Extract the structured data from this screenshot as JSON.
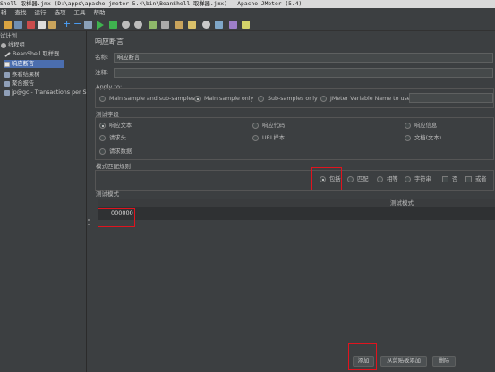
{
  "window": {
    "title": "Shell 取样器.jmx (D:\\apps\\apache-jmeter-5.4\\bin\\BeanShell 取样器.jmx) - Apache JMeter (5.4)"
  },
  "menu": [
    "辑",
    "查找",
    "运行",
    "选项",
    "工具",
    "帮助"
  ],
  "tree": {
    "items": [
      {
        "label": "试计划",
        "icon": "test-plan-icon"
      },
      {
        "label": "线程组",
        "icon": "thread-group-icon"
      },
      {
        "label": "BeanShell 取样器",
        "icon": "pen-icon"
      },
      {
        "label": "响应断言",
        "icon": "assertion-icon",
        "selected": true
      },
      {
        "label": "察看结果树",
        "icon": "listener-icon"
      },
      {
        "label": "聚合报告",
        "icon": "listener-icon"
      },
      {
        "label": "jp@gc - Transactions per S",
        "icon": "listener-icon"
      }
    ]
  },
  "panel": {
    "title": "响应断言",
    "name_label": "名称:",
    "name_value": "响应断言",
    "comment_label": "注释:",
    "comment_value": "",
    "apply_to": {
      "label": "Apply to:",
      "options": [
        "Main sample and sub-samples",
        "Main sample only",
        "Sub-samples only",
        "JMeter Variable Name to use"
      ],
      "selected": "Main sample only"
    },
    "test_field": {
      "label": "测试字段",
      "options": [
        "响应文本",
        "响应代码",
        "响应信息",
        "请求头",
        "URL样本",
        "文档(文本)",
        "请求数据"
      ],
      "selected": "响应文本"
    },
    "match_rules": {
      "label": "模式匹配规则",
      "options": [
        "包括",
        "匹配",
        "相等",
        "字符串"
      ],
      "selected": "包括",
      "checkbox_not": "否",
      "checkbox_or": "或者"
    },
    "patterns": {
      "label": "测试模式",
      "column": "测试模式",
      "rows": [
        "000000"
      ]
    },
    "buttons": {
      "add": "添加",
      "add_clipboard": "从剪贴板添加",
      "delete": "删除"
    }
  },
  "colors": {
    "background": "#3c3f41",
    "selection": "#4b6eaf",
    "highlight_box": "#e0141e"
  }
}
